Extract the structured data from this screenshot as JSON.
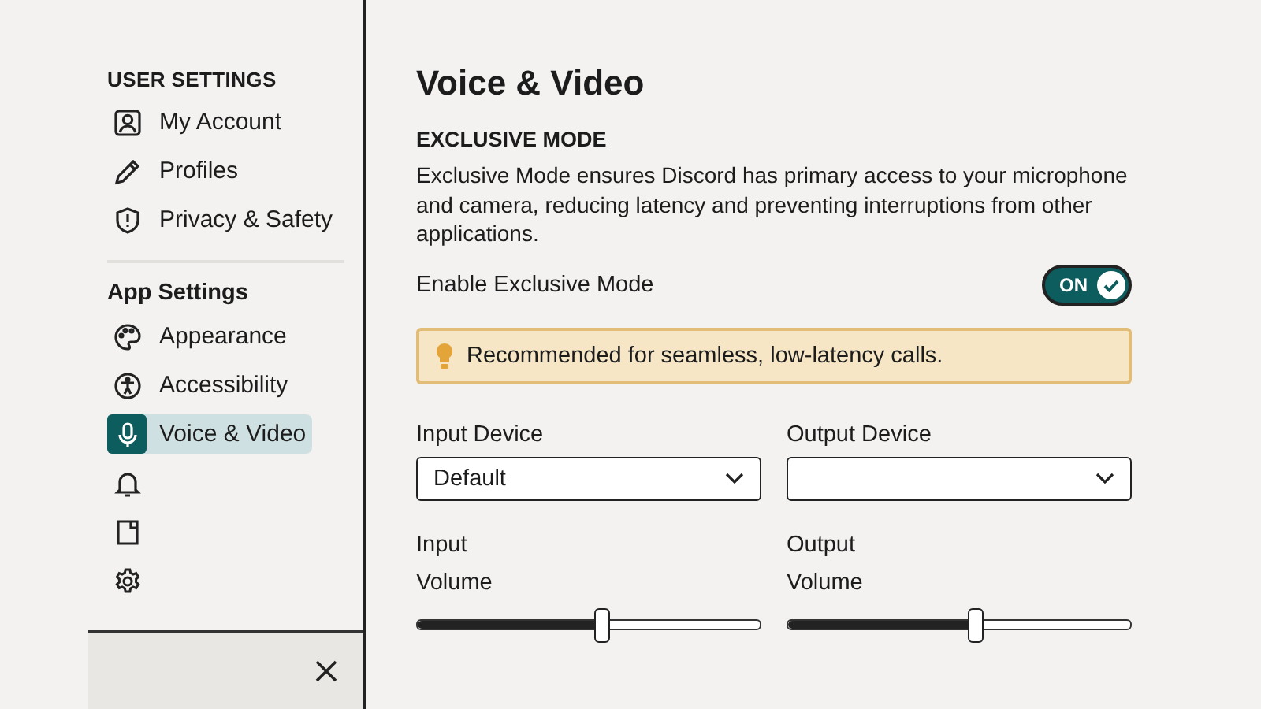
{
  "sidebar": {
    "sections": [
      {
        "heading": "USER SETTINGS",
        "items": [
          {
            "label": "My Account",
            "selected": false
          },
          {
            "label": "Profiles",
            "selected": false
          },
          {
            "label": "Privacy & Safety",
            "selected": false
          }
        ]
      },
      {
        "heading": "App Settings",
        "items": [
          {
            "label": "Appearance",
            "selected": false
          },
          {
            "label": "Accessibility",
            "selected": false
          },
          {
            "label": "Voice & Video",
            "selected": true
          },
          {
            "selected": false
          },
          {
            "selected": false
          },
          {
            "selected": false
          }
        ]
      }
    ]
  },
  "main": {
    "title": "Voice & Video",
    "section_heading": "EXCLUSIVE MODE",
    "description": "Exclusive Mode ensures Discord has primary access to your microphone and camera, reducing latency and preventing interruptions from other applications.",
    "toggle": {
      "label": "Enable Exclusive Mode",
      "on": true,
      "state_text": "ON"
    },
    "callout": {
      "text": "Recommended for seamless, low-latency calls."
    },
    "devices": [
      {
        "label": "Input Device",
        "value": "Default",
        "volume_label": [
          "Input",
          "Volume"
        ],
        "level": 0.54
      },
      {
        "label": "Output Device",
        "volume_label": [
          "Output",
          "Volume"
        ],
        "level": 0.55
      }
    ]
  }
}
